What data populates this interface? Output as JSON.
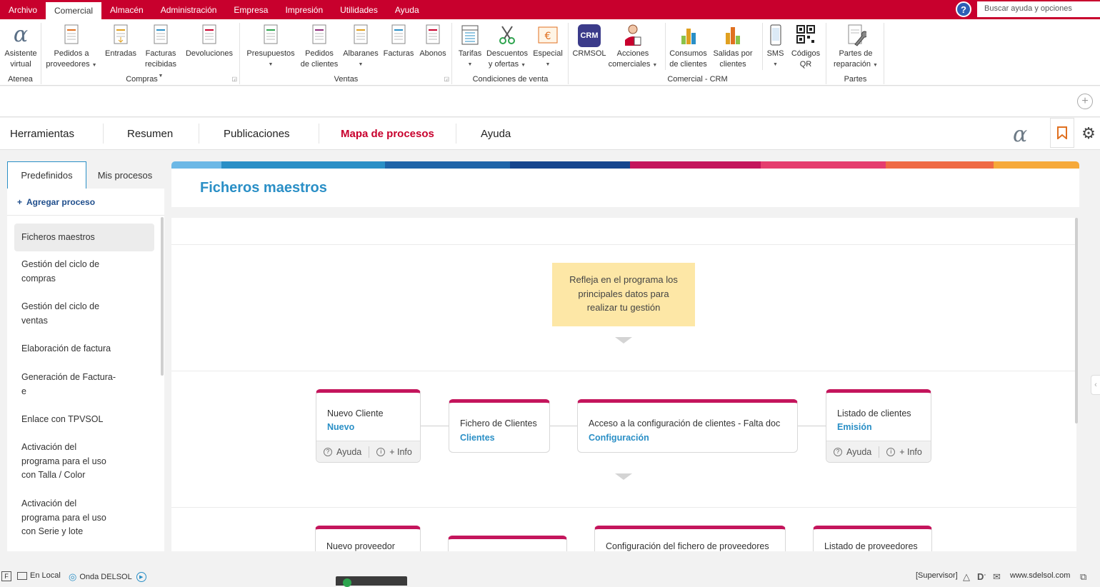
{
  "menubar": {
    "items": [
      "Archivo",
      "Comercial",
      "Almacén",
      "Administración",
      "Empresa",
      "Impresión",
      "Utilidades",
      "Ayuda"
    ],
    "active": "Comercial",
    "search_placeholder": "Buscar ayuda y opciones"
  },
  "ribbon": {
    "groups": [
      {
        "label": "Atenea",
        "buttons": [
          {
            "line1": "Asistente",
            "line2": "virtual",
            "icon": "alpha-icon"
          }
        ]
      },
      {
        "label": "Compras",
        "buttons": [
          {
            "line1": "Pedidos a",
            "line2": "proveedores",
            "icon": "document-icon",
            "dropdown": true
          },
          {
            "line1": "Entradas",
            "line2": "",
            "icon": "document-icon"
          },
          {
            "line1": "Facturas",
            "line2": "recibidas",
            "icon": "document-icon",
            "dropdown": true
          },
          {
            "line1": "Devoluciones",
            "line2": "",
            "icon": "document-icon"
          }
        ]
      },
      {
        "label": "Ventas",
        "buttons": [
          {
            "line1": "Presupuestos",
            "line2": "",
            "icon": "document-icon",
            "dropdown": true
          },
          {
            "line1": "Pedidos",
            "line2": "de clientes",
            "icon": "document-icon"
          },
          {
            "line1": "Albaranes",
            "line2": "",
            "icon": "document-icon",
            "dropdown": true
          },
          {
            "line1": "Facturas",
            "line2": "",
            "icon": "document-icon"
          },
          {
            "line1": "Abonos",
            "line2": "",
            "icon": "document-icon"
          }
        ]
      },
      {
        "label": "Condiciones de venta",
        "buttons": [
          {
            "line1": "Tarifas",
            "line2": "",
            "icon": "price-list-icon",
            "dropdown": true
          },
          {
            "line1": "Descuentos",
            "line2": "y ofertas",
            "icon": "scissors-icon",
            "dropdown": true
          },
          {
            "line1": "Especial",
            "line2": "",
            "icon": "euro-icon",
            "dropdown": true
          }
        ]
      },
      {
        "label": "Comercial - CRM",
        "buttons": [
          {
            "line1": "CRMSOL",
            "line2": "",
            "icon": "crm-icon"
          },
          {
            "line1": "Acciones",
            "line2": "comerciales",
            "icon": "person-icon",
            "dropdown": true
          },
          {
            "line1": "Consumos",
            "line2": "de clientes",
            "icon": "bar-chart-icon"
          },
          {
            "line1": "Salidas por",
            "line2": "clientes",
            "icon": "bar-chart-icon"
          },
          {
            "line1": "SMS",
            "line2": "",
            "icon": "phone-icon",
            "dropdown": true
          },
          {
            "line1": "Códigos",
            "line2": "QR",
            "icon": "qr-code-icon"
          }
        ]
      },
      {
        "label": "Partes",
        "buttons": [
          {
            "line1": "Partes de",
            "line2": "reparación",
            "icon": "wrench-icon",
            "dropdown": true
          }
        ]
      }
    ],
    "crm_badge": "CRM"
  },
  "nav": {
    "tabs": [
      "Herramientas",
      "Resumen",
      "Publicaciones",
      "Mapa de procesos",
      "Ayuda"
    ],
    "active": "Mapa de procesos",
    "logo": "α"
  },
  "sidebar": {
    "subtabs": [
      "Predefinidos",
      "Mis procesos"
    ],
    "active_subtab": "Predefinidos",
    "add_label": "Agregar proceso",
    "add_plus": "+",
    "items": [
      [
        "Ficheros maestros"
      ],
      [
        "Gestión del ciclo de",
        "compras"
      ],
      [
        "Gestión del ciclo de",
        "ventas"
      ],
      [
        "Elaboración de factura"
      ],
      [
        "Generación de Factura-",
        "e"
      ],
      [
        "Enlace con TPVSOL"
      ],
      [
        "Activación del",
        "programa para el uso",
        "con Talla / Color"
      ],
      [
        "Activación del",
        "programa para el uso",
        "con Serie y lote"
      ]
    ],
    "active_item": "Ficheros maestros"
  },
  "main": {
    "title": "Ficheros maestros",
    "colorbar": [
      "#6cb8e6",
      "#2a8fc6",
      "#1f64a8",
      "#15458d",
      "#c4155c",
      "#e53d6e",
      "#ef6a45",
      "#f6a93a"
    ],
    "note": [
      "Refleja en el programa los",
      "principales datos para",
      "realizar tu gestión"
    ],
    "row1": [
      {
        "title": "Nuevo Cliente",
        "link": "Nuevo",
        "footer": true
      },
      {
        "title": "Fichero de Clientes",
        "link": "Clientes",
        "footer": false
      },
      {
        "title": "Acceso a la configuración de clientes - Falta doc",
        "link": "Configuración",
        "footer": false
      },
      {
        "title": "Listado de clientes",
        "link": "Emisión",
        "footer": true
      }
    ],
    "footer_help": "Ayuda",
    "footer_info": "+ Info",
    "row2": [
      {
        "title": "Nuevo proveedor"
      },
      {
        "title": ""
      },
      {
        "title": "Configuración del fichero de proveedores"
      },
      {
        "title": "Listado de proveedores"
      }
    ]
  },
  "statusbar": {
    "f_label": "F",
    "mode": "En Local",
    "onda": "Onda DELSOL",
    "user": "[Supervisor]",
    "website": "www.sdelsol.com"
  },
  "colors": {
    "brand_red": "#c8002d",
    "accent_blue": "#2a8fc6",
    "card_top": "#c4155c",
    "note_bg": "#fde7a6"
  }
}
